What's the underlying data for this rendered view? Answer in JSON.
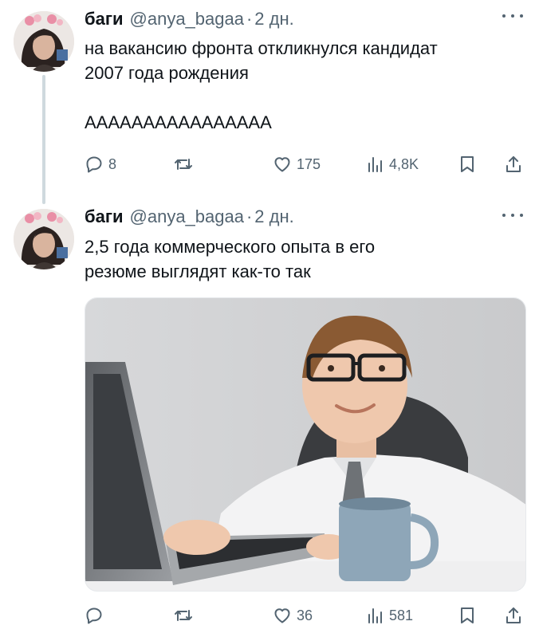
{
  "tweets": [
    {
      "author_name": "баги",
      "author_handle": "@anya_bagaa",
      "separator": "·",
      "time": "2 дн.",
      "text_lines": [
        "на вакансию фронта откликнулся кандидат",
        "2007 года рождения",
        "",
        "АААААААААААААААА"
      ],
      "replies": "8",
      "retweets": "",
      "likes": "175",
      "views": "4,8K",
      "has_thread_line": true
    },
    {
      "author_name": "баги",
      "author_handle": "@anya_bagaa",
      "separator": "·",
      "time": "2 дн.",
      "text_lines": [
        "2,5 года коммерческого опыта в его",
        "резюме выглядят как-то так"
      ],
      "replies": "",
      "retweets": "",
      "likes": "36",
      "views": "581",
      "has_media": true
    }
  ],
  "icons": {
    "reply": "reply-icon",
    "retweet": "retweet-icon",
    "like": "heart-icon",
    "views": "views-icon",
    "bookmark": "bookmark-icon",
    "share": "share-icon",
    "more": "more-icon"
  },
  "colors": {
    "text": "#0f1419",
    "secondary": "#536471",
    "thread_line": "#cfd9de",
    "background": "#ffffff"
  }
}
